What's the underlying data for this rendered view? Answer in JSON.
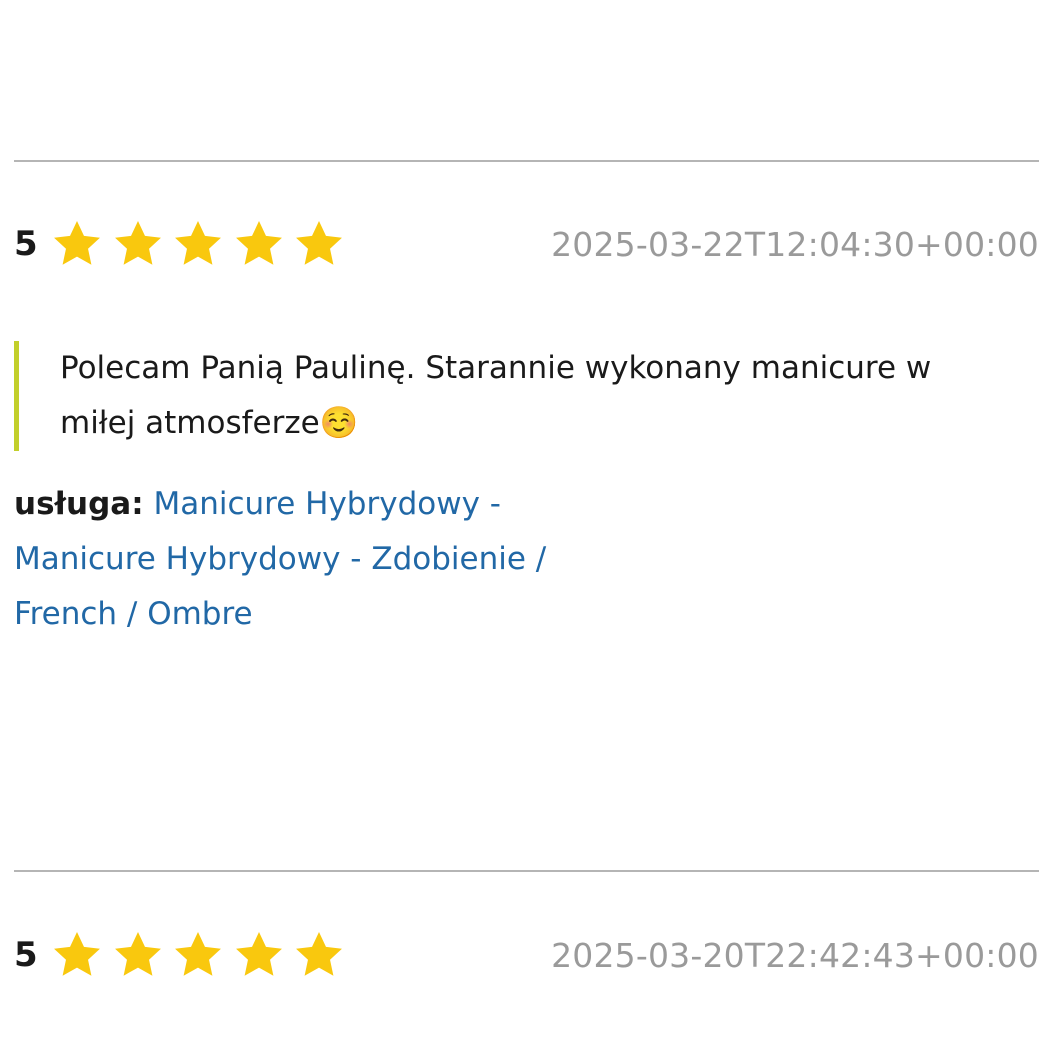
{
  "reviews": [
    {
      "rating": "5",
      "stars": 5,
      "date": "2025-03-22T12:04:30+00:00",
      "text": "Polecam Panią Paulinę. Starannie wykonany manicure w miłej atmosferze☺️",
      "service_label": "usługa:",
      "service_link": "Manicure Hybrydowy - Manicure Hybrydowy - Zdobienie / French / Ombre"
    },
    {
      "rating": "5",
      "stars": 5,
      "date": "2025-03-20T22:42:43+00:00"
    }
  ],
  "colors": {
    "star": "#f9c80e",
    "link": "#2168a6",
    "quote_border": "#c2cf2b",
    "date": "#9a9a9a",
    "divider": "#b5b5b5"
  }
}
